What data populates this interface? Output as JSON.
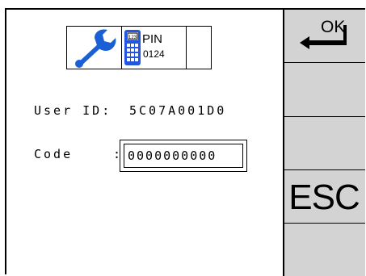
{
  "header": {
    "pin_icon_text": "PIN",
    "pin_icon_number": "0124",
    "keypad_icon_text": "123"
  },
  "form": {
    "user_id_label": "User ID:",
    "user_id_value": "5C07A001D0",
    "code_label": "Code",
    "code_colon": ":",
    "code_value": "0000000000"
  },
  "softkeys": {
    "ok_label": "OK",
    "esc_label": "ESC"
  },
  "icons": {
    "wrench": "wrench-icon",
    "pin_keypad": "pin-keypad-icon",
    "enter_arrow": "enter-arrow-icon"
  },
  "colors": {
    "wrench_blue": "#1a5fd6",
    "keypad_blue": "#2255e0",
    "softkey_bg": "#d3d3d3"
  }
}
